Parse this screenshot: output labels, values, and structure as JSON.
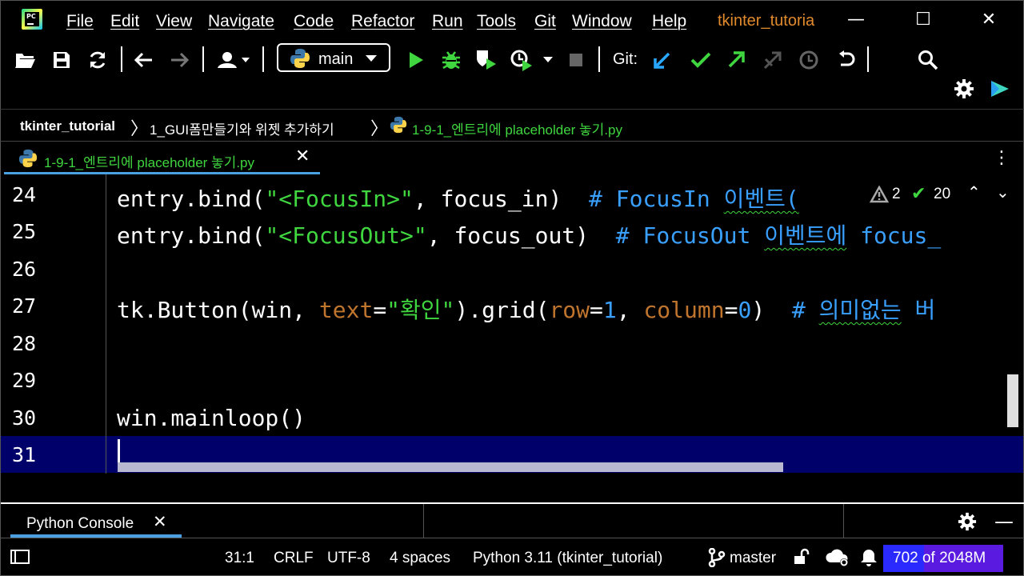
{
  "menubar": {
    "items": [
      "File",
      "Edit",
      "View",
      "Navigate",
      "Code",
      "Refactor",
      "Run",
      "Tools",
      "Git",
      "Window",
      "Help"
    ],
    "project_title": "tkinter_tutoria",
    "minimize": "—",
    "maximize": "☐",
    "close": "✕"
  },
  "toolbar": {
    "branch": "main",
    "git_label": "Git:"
  },
  "breadcrumb": {
    "project": "tkinter_tutorial",
    "folder": "1_GUI폼만들기와 위젯 추가하기",
    "file": "1-9-1_엔트리에 placeholder 놓기.py"
  },
  "tabs": {
    "active_label": "1-9-1_엔트리에 placeholder 놓기.py",
    "close": "✕",
    "menu": "⋮"
  },
  "editor": {
    "line_numbers": [
      "24",
      "25",
      "26",
      "27",
      "28",
      "29",
      "30",
      "31"
    ],
    "line24": {
      "a": "entry.bind(",
      "b": "\"<FocusIn>\"",
      "c": ", focus_in)  ",
      "d": "# FocusIn ",
      "e": "이벤트("
    },
    "line25": {
      "a": "entry.bind(",
      "b": "\"<FocusOut>\"",
      "c": ", focus_out)  ",
      "d": "# FocusOut ",
      "e": "이벤트에",
      "f": " focus_"
    },
    "line27": {
      "a": "tk.Button(win, ",
      "b": "text",
      "c": "=",
      "d": "\"확인\"",
      "e": ").grid(",
      "f": "row",
      "g": "=",
      "h": "1",
      "i": ", ",
      "j": "column",
      "k": "=",
      "l": "0",
      "m": ")  ",
      "n": "# ",
      "o": "의미없는",
      "p": " 버"
    },
    "line30": "win.mainloop()",
    "inspections": {
      "warnings": "2",
      "ok": "20",
      "up": "⌃",
      "down": "⌄"
    }
  },
  "tool_window": {
    "tab_label": "Python Console",
    "close": "✕",
    "minimize": "—"
  },
  "statusbar": {
    "position": "31:1",
    "line_sep": "CRLF",
    "encoding": "UTF-8",
    "indent": "4 spaces",
    "interpreter": "Python 3.11 (tkinter_tutorial)",
    "branch": "master",
    "memory_text": "702 of 2048M",
    "memory_used_fraction": 0.343
  },
  "colors": {
    "accent": "#4aa0e0",
    "string": "#3fd63f",
    "keyword_arg": "#c0752e",
    "comment": "#3aa0ff",
    "current_line": "#00006b",
    "project_title": "#e08a2c"
  }
}
